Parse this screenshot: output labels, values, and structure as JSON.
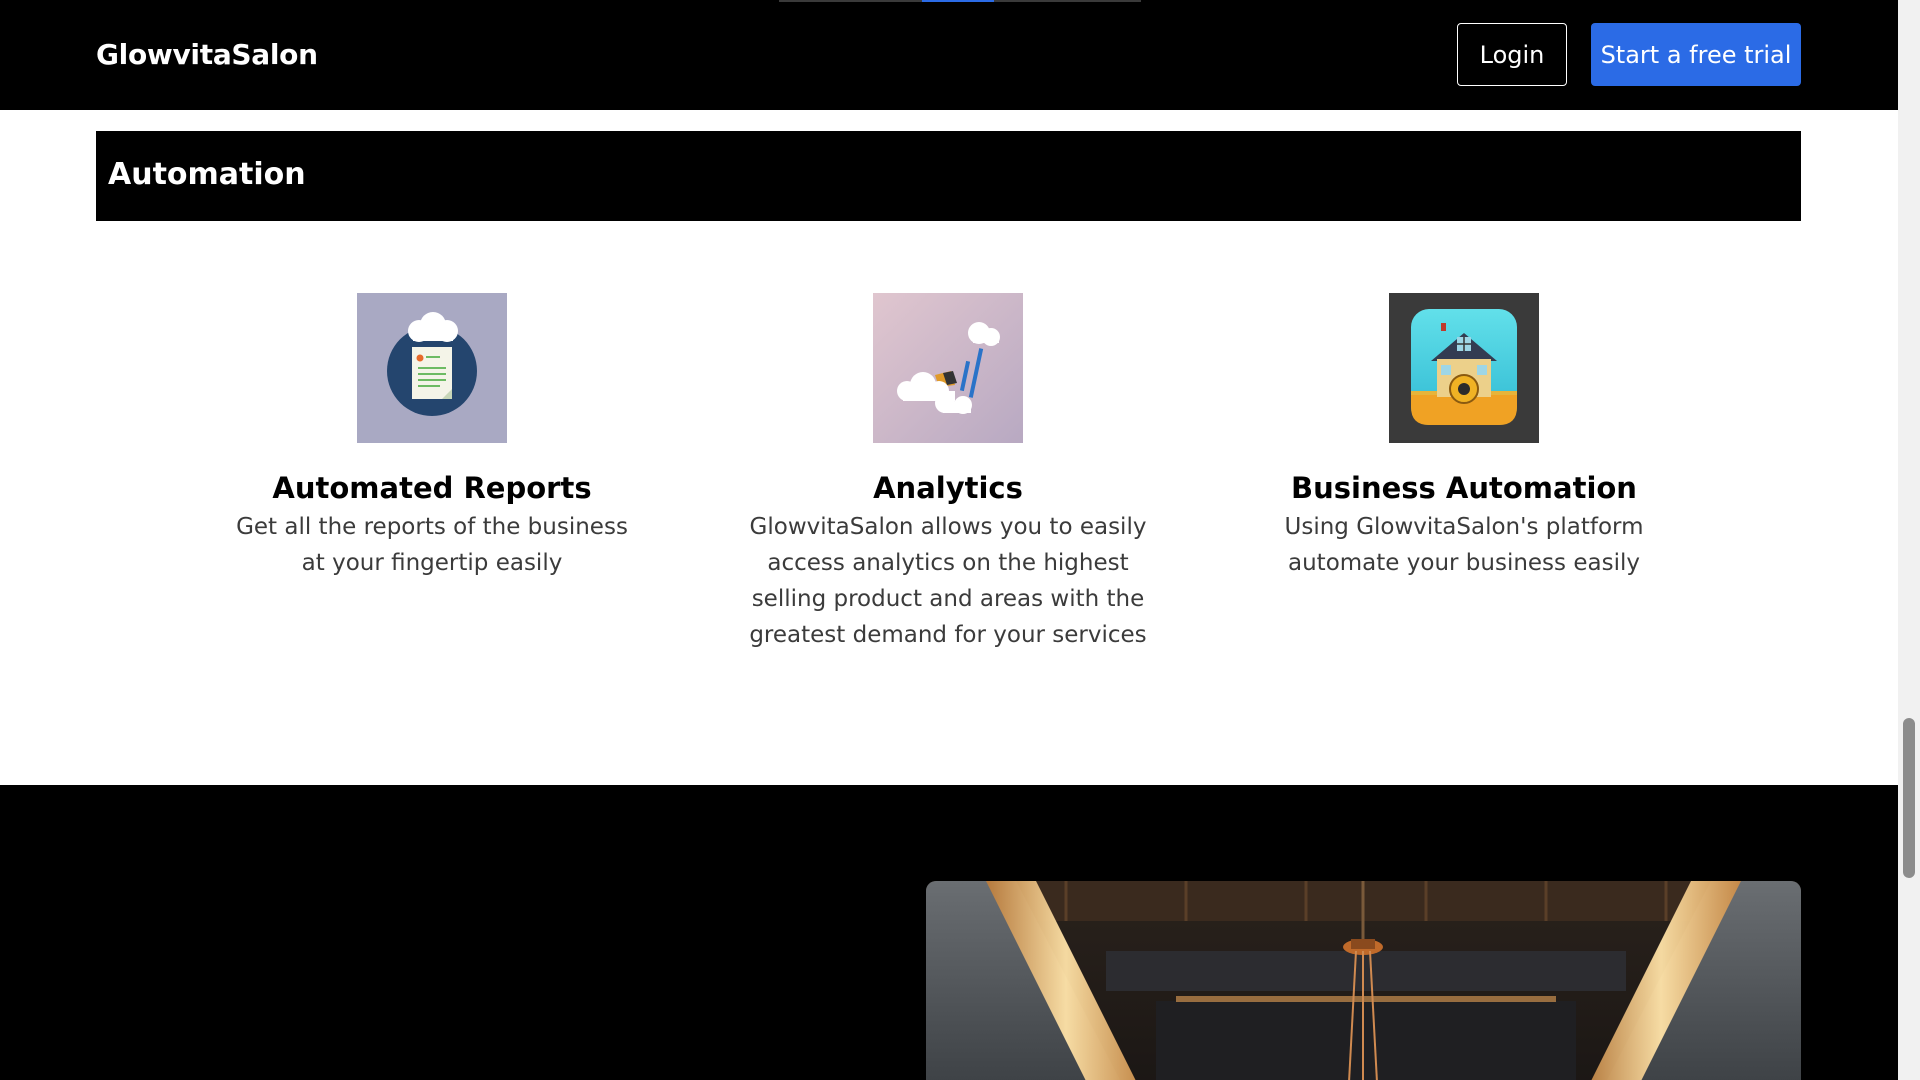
{
  "header": {
    "brand": "GlowvitaSalon",
    "login_label": "Login",
    "trial_label": "Start a free trial"
  },
  "section": {
    "title": "Automation"
  },
  "features": [
    {
      "icon": "cloud-report-icon",
      "title": "Automated Reports",
      "description": "Get all the reports of the business at your fingertip easily"
    },
    {
      "icon": "cloud-analytics-icon",
      "title": "Analytics",
      "description": "GlowvitaSalon allows you to easily access analytics on the highest selling product and areas with the greatest demand for your services"
    },
    {
      "icon": "house-gear-icon",
      "title": "Business Automation",
      "description": "Using GlowvitaSalon's platform automate your business easily"
    }
  ],
  "colors": {
    "accent": "#2b6be6",
    "dark": "#000000",
    "text_muted": "#3b3b3b"
  }
}
